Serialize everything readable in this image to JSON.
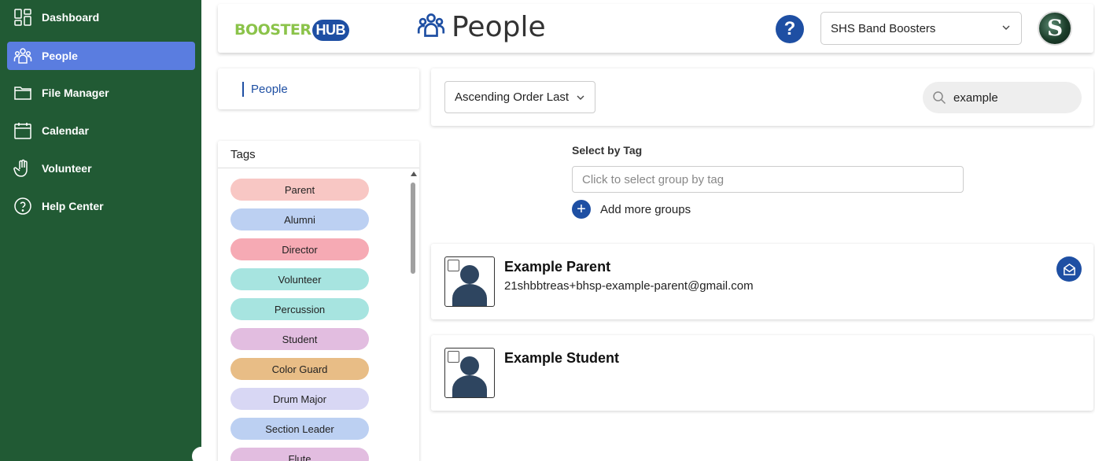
{
  "sidebar": {
    "items": [
      {
        "label": "Dashboard",
        "icon": "dashboard-icon",
        "active": false
      },
      {
        "label": "People",
        "icon": "people-icon",
        "active": true
      },
      {
        "label": "File Manager",
        "icon": "folder-icon",
        "active": false
      },
      {
        "label": "Calendar",
        "icon": "calendar-icon",
        "active": false
      },
      {
        "label": "Volunteer",
        "icon": "hand-icon",
        "active": false
      },
      {
        "label": "Help Center",
        "icon": "help-circle-icon",
        "active": false
      }
    ],
    "background": "#215a34",
    "active_color": "#5a7de0"
  },
  "header": {
    "logo_booster": "BOOSTER",
    "logo_hub": "HUB",
    "page_title": "People",
    "help_label": "?",
    "org_selected": "SHS Band Boosters",
    "accent": "#1e4fa3"
  },
  "breadcrumb": {
    "label": "People"
  },
  "tags": {
    "title": "Tags",
    "items": [
      {
        "label": "Parent",
        "color": "#f8c7c4"
      },
      {
        "label": "Alumni",
        "color": "#bcd0f2"
      },
      {
        "label": "Director",
        "color": "#f6aab4"
      },
      {
        "label": "Volunteer",
        "color": "#a7e4e0"
      },
      {
        "label": "Percussion",
        "color": "#a7e4e0"
      },
      {
        "label": "Student",
        "color": "#e2bde0"
      },
      {
        "label": "Color Guard",
        "color": "#e8bd86"
      },
      {
        "label": "Drum Major",
        "color": "#d8d7f4"
      },
      {
        "label": "Section Leader",
        "color": "#bcd0f2"
      },
      {
        "label": "Flute",
        "color": "#e2bde0"
      }
    ]
  },
  "filters": {
    "sort_value": "Ascending Order Last",
    "search_value": "example"
  },
  "select_by_tag": {
    "label": "Select by Tag",
    "placeholder": "Click to select group by tag",
    "add_more_label": "Add more groups"
  },
  "people": [
    {
      "name": "Example Parent",
      "email": "21shbbtreas+bhsp-example-parent@gmail.com",
      "has_mail": true
    },
    {
      "name": "Example Student",
      "email": "",
      "has_mail": false
    }
  ]
}
